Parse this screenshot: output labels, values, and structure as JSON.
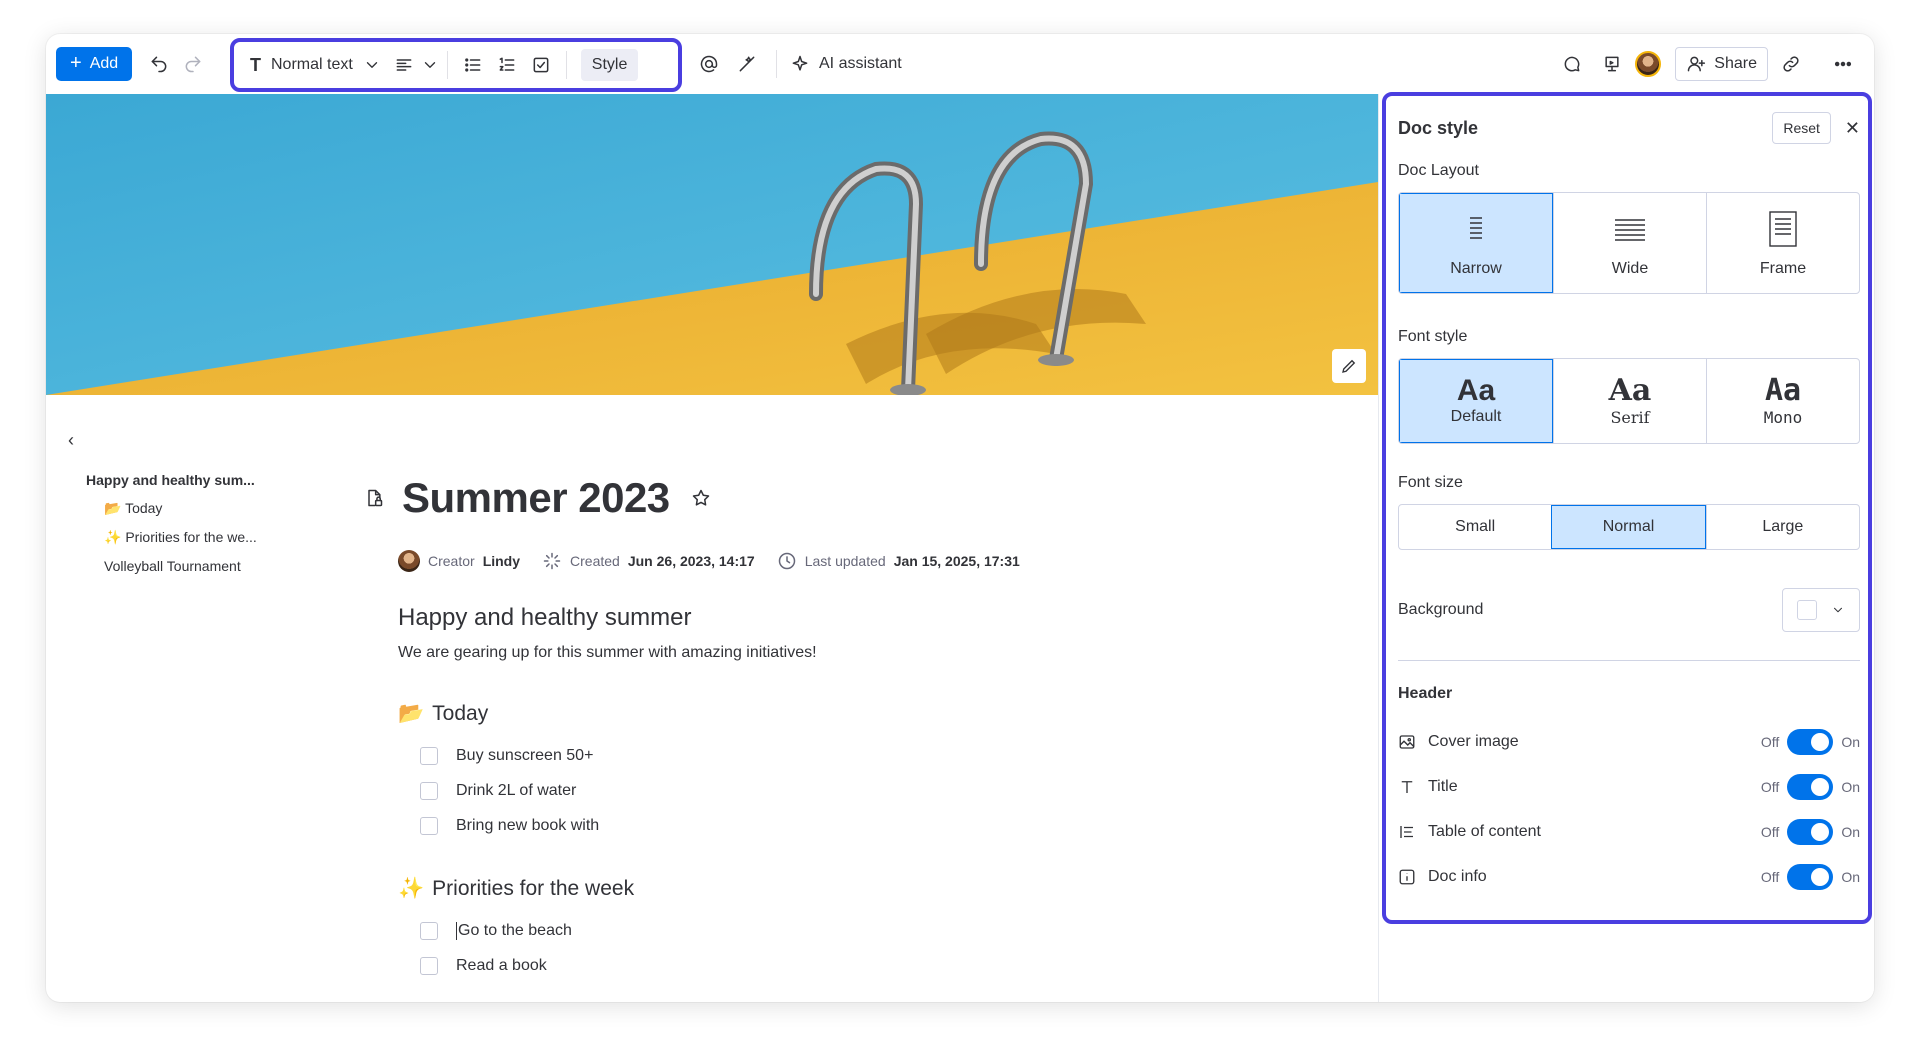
{
  "toolbar": {
    "add_label": "Add",
    "text_style": "Normal text",
    "style_label": "Style",
    "ai_label": "AI assistant",
    "share_label": "Share"
  },
  "toc": {
    "root": "Happy and healthy sum...",
    "items": [
      "📂 Today",
      "✨ Priorities for the we...",
      "Volleyball Tournament"
    ]
  },
  "doc": {
    "title": "Summer 2023",
    "creator_label": "Creator",
    "creator": "Lindy",
    "created_label": "Created",
    "created": "Jun 26, 2023, 14:17",
    "updated_label": "Last updated",
    "updated": "Jan 15, 2025, 17:31",
    "heading": "Happy and healthy summer",
    "intro": "We are gearing up for this summer with amazing initiatives!",
    "sections": [
      {
        "emoji": "📂",
        "title": "Today",
        "items": [
          "Buy sunscreen 50+",
          "Drink 2L of water",
          "Bring new book with"
        ]
      },
      {
        "emoji": "✨",
        "title": "Priorities for the week",
        "items": [
          "Go to the beach",
          "Read a book"
        ]
      }
    ]
  },
  "panel": {
    "title": "Doc style",
    "reset": "Reset",
    "layout_label": "Doc Layout",
    "layouts": [
      "Narrow",
      "Wide",
      "Frame"
    ],
    "layout_selected": "Narrow",
    "font_style_label": "Font style",
    "font_sample": "Aa",
    "fonts": [
      "Default",
      "Serif",
      "Mono"
    ],
    "font_selected": "Default",
    "font_size_label": "Font size",
    "sizes": [
      "Small",
      "Normal",
      "Large"
    ],
    "size_selected": "Normal",
    "background_label": "Background",
    "header_label": "Header",
    "off": "Off",
    "on": "On",
    "toggles": [
      {
        "label": "Cover image",
        "icon": "image-icon",
        "state": "on"
      },
      {
        "label": "Title",
        "icon": "text-icon",
        "state": "on"
      },
      {
        "label": "Table of content",
        "icon": "list-icon",
        "state": "on"
      },
      {
        "label": "Doc info",
        "icon": "info-icon",
        "state": "on"
      }
    ]
  },
  "colors": {
    "accent": "#0073ea",
    "highlight_frame": "#4a3ee0",
    "selected_bg": "#cce5ff"
  }
}
